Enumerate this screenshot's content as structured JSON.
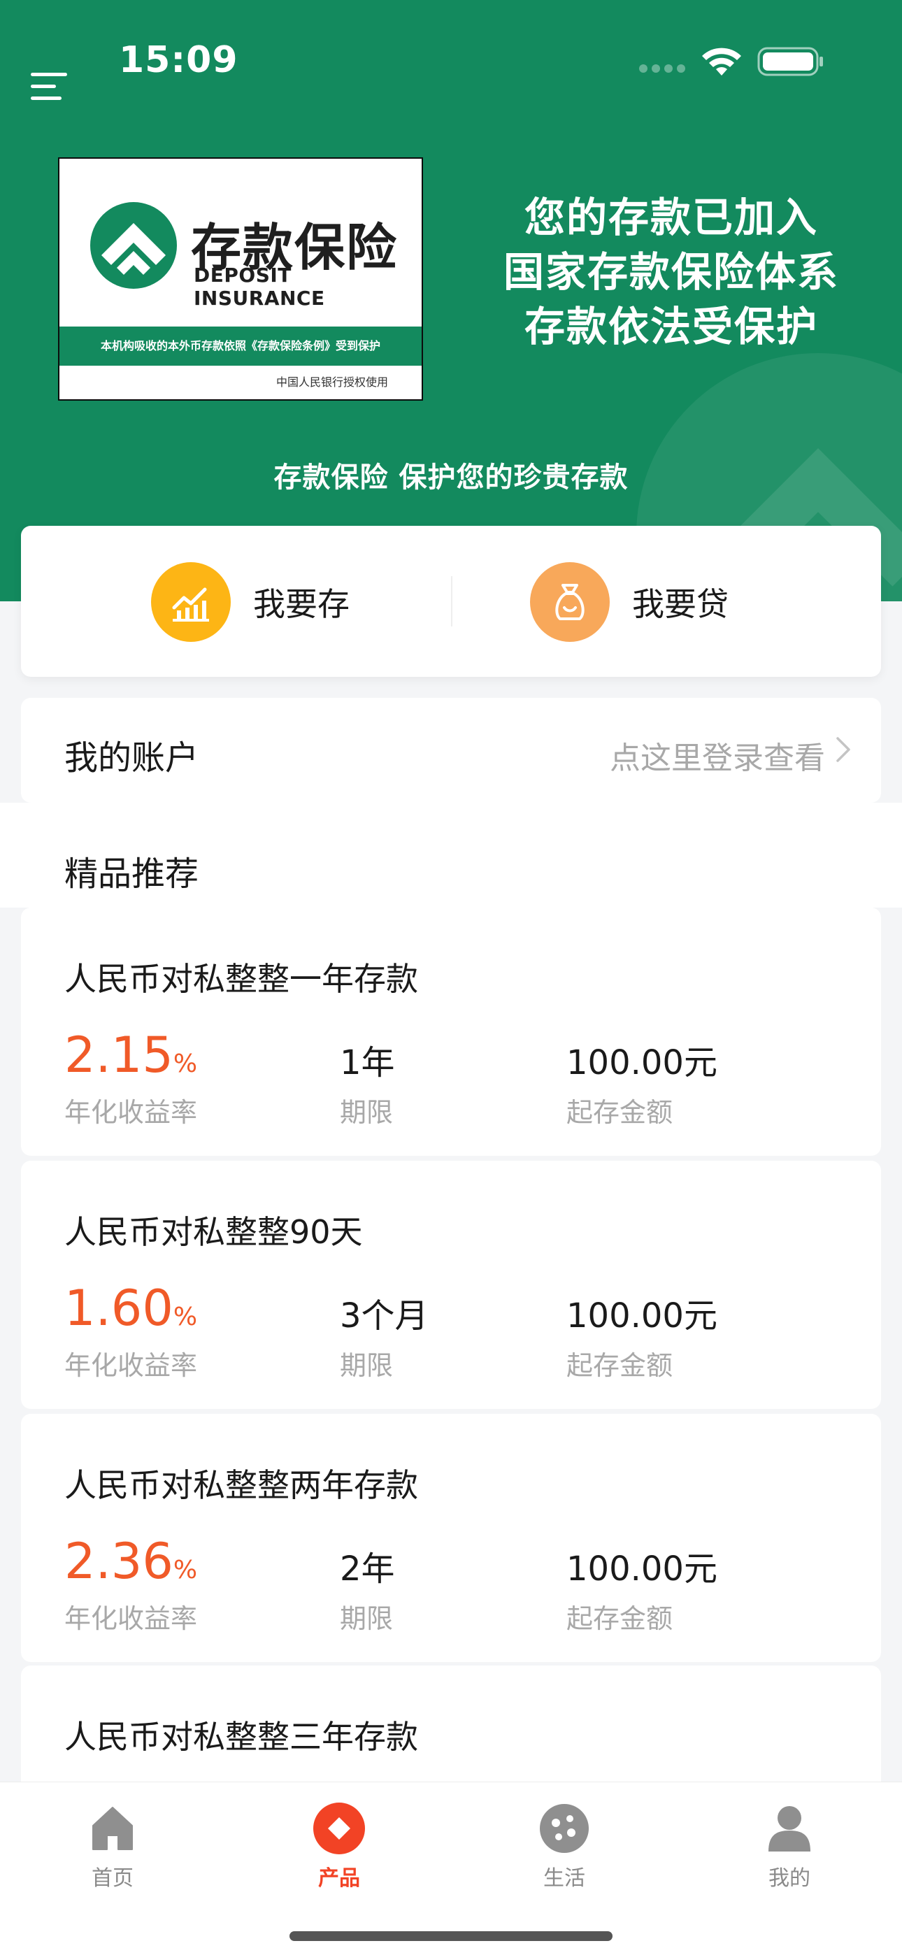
{
  "status_bar": {
    "time": "15:09"
  },
  "hero": {
    "badge": {
      "title": "存款保险",
      "subtitle": "DEPOSIT INSURANCE",
      "band_text": "本机构吸收的本外币存款依照《存款保险条例》受到保护",
      "footer": "中国人民银行授权使用"
    },
    "slogan": [
      "您的存款已加入",
      "国家存款保险体系",
      "存款依法受保护"
    ],
    "caption": "存款保险 保护您的珍贵存款"
  },
  "quick_actions": [
    {
      "label": "我要存",
      "icon": "chart-up-icon"
    },
    {
      "label": "我要贷",
      "icon": "money-bag-icon"
    }
  ],
  "account": {
    "label": "我的账户",
    "link": "点这里登录查看"
  },
  "section": {
    "title": "精品推荐"
  },
  "products": [
    {
      "name": "人民币对私整整一年存款",
      "rate": "2.15",
      "rate_unit": "%",
      "rate_label": "年化收益率",
      "term": "1年",
      "term_label": "期限",
      "min": "100.00元",
      "min_label": "起存金额"
    },
    {
      "name": "人民币对私整整90天",
      "rate": "1.60",
      "rate_unit": "%",
      "rate_label": "年化收益率",
      "term": "3个月",
      "term_label": "期限",
      "min": "100.00元",
      "min_label": "起存金额"
    },
    {
      "name": "人民币对私整整两年存款",
      "rate": "2.36",
      "rate_unit": "%",
      "rate_label": "年化收益率",
      "term": "2年",
      "term_label": "期限",
      "min": "100.00元",
      "min_label": "起存金额"
    },
    {
      "name": "人民币对私整整三年存款"
    }
  ],
  "tabbar": [
    {
      "label": "首页",
      "icon": "home-icon",
      "active": false
    },
    {
      "label": "产品",
      "icon": "product-icon",
      "active": true
    },
    {
      "label": "生活",
      "icon": "life-icon",
      "active": false
    },
    {
      "label": "我的",
      "icon": "profile-icon",
      "active": false
    }
  ],
  "colors": {
    "brand_green": "#138a5e",
    "rate_orange": "#f05a28",
    "tab_active": "#f24325",
    "save_icon_bg": "#fdb515",
    "loan_icon_bg": "#f8a85a"
  }
}
